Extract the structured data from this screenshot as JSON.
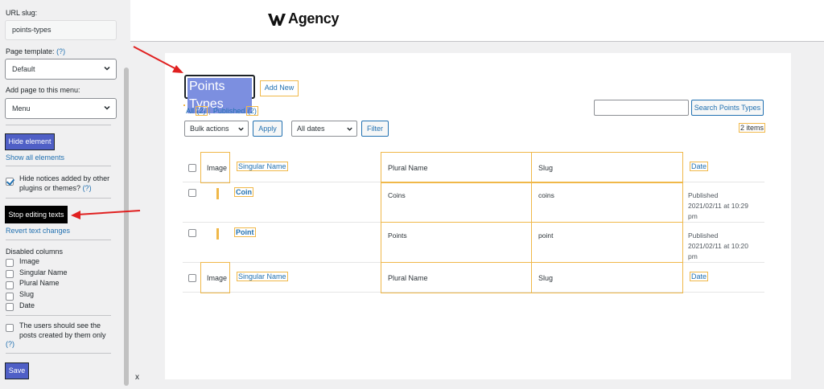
{
  "sidebar": {
    "url_slug_label": "URL slug:",
    "url_slug_value": "points-types",
    "page_template_label": "Page template:",
    "page_template_help": "(?)",
    "page_template_value": "Default",
    "add_to_menu_label": "Add page to this menu:",
    "menu_value": "Menu",
    "hide_element": "Hide element",
    "show_all": "Show all elements",
    "hide_notices_line1": "Hide notices added by other",
    "hide_notices_line2": "plugins or themes?",
    "hide_notices_help": "(?)",
    "stop_editing": "Stop editing texts",
    "revert": "Revert text changes",
    "disabled_columns_label": "Disabled columns",
    "columns": [
      "Image",
      "Singular Name",
      "Plural Name",
      "Slug",
      "Date"
    ],
    "users_line1": "The users should see the",
    "users_line2": "posts created by them only",
    "users_help": "(?)",
    "save": "Save",
    "close": "x"
  },
  "header": {
    "logo_text": "Agency"
  },
  "main": {
    "title": "Points Types",
    "add_new": "Add New",
    "filter_all": "All",
    "filter_all_count": "(2)",
    "filter_sep": "|",
    "filter_published": "Published",
    "filter_published_count": "(2)",
    "search_button": "Search Points Types",
    "bulk_actions": "Bulk actions",
    "apply": "Apply",
    "all_dates": "All dates",
    "filter": "Filter",
    "items_count": "2 items",
    "columns": {
      "image": "Image",
      "singular": "Singular Name",
      "plural": "Plural Name",
      "slug": "Slug",
      "date": "Date"
    },
    "rows": [
      {
        "singular": "Coin",
        "plural": "Coins",
        "slug": "coins",
        "status": "Published",
        "date": "2021/02/11 at 10:29",
        "ampm": "pm"
      },
      {
        "singular": "Point",
        "plural": "Points",
        "slug": "point",
        "status": "Published",
        "date": "2021/02/11 at 10:20",
        "ampm": "pm"
      }
    ]
  },
  "colors": {
    "accent_blue": "#4f5fc6",
    "link": "#2271b1",
    "highlight": "#f0b849",
    "arrow": "#e02020"
  }
}
